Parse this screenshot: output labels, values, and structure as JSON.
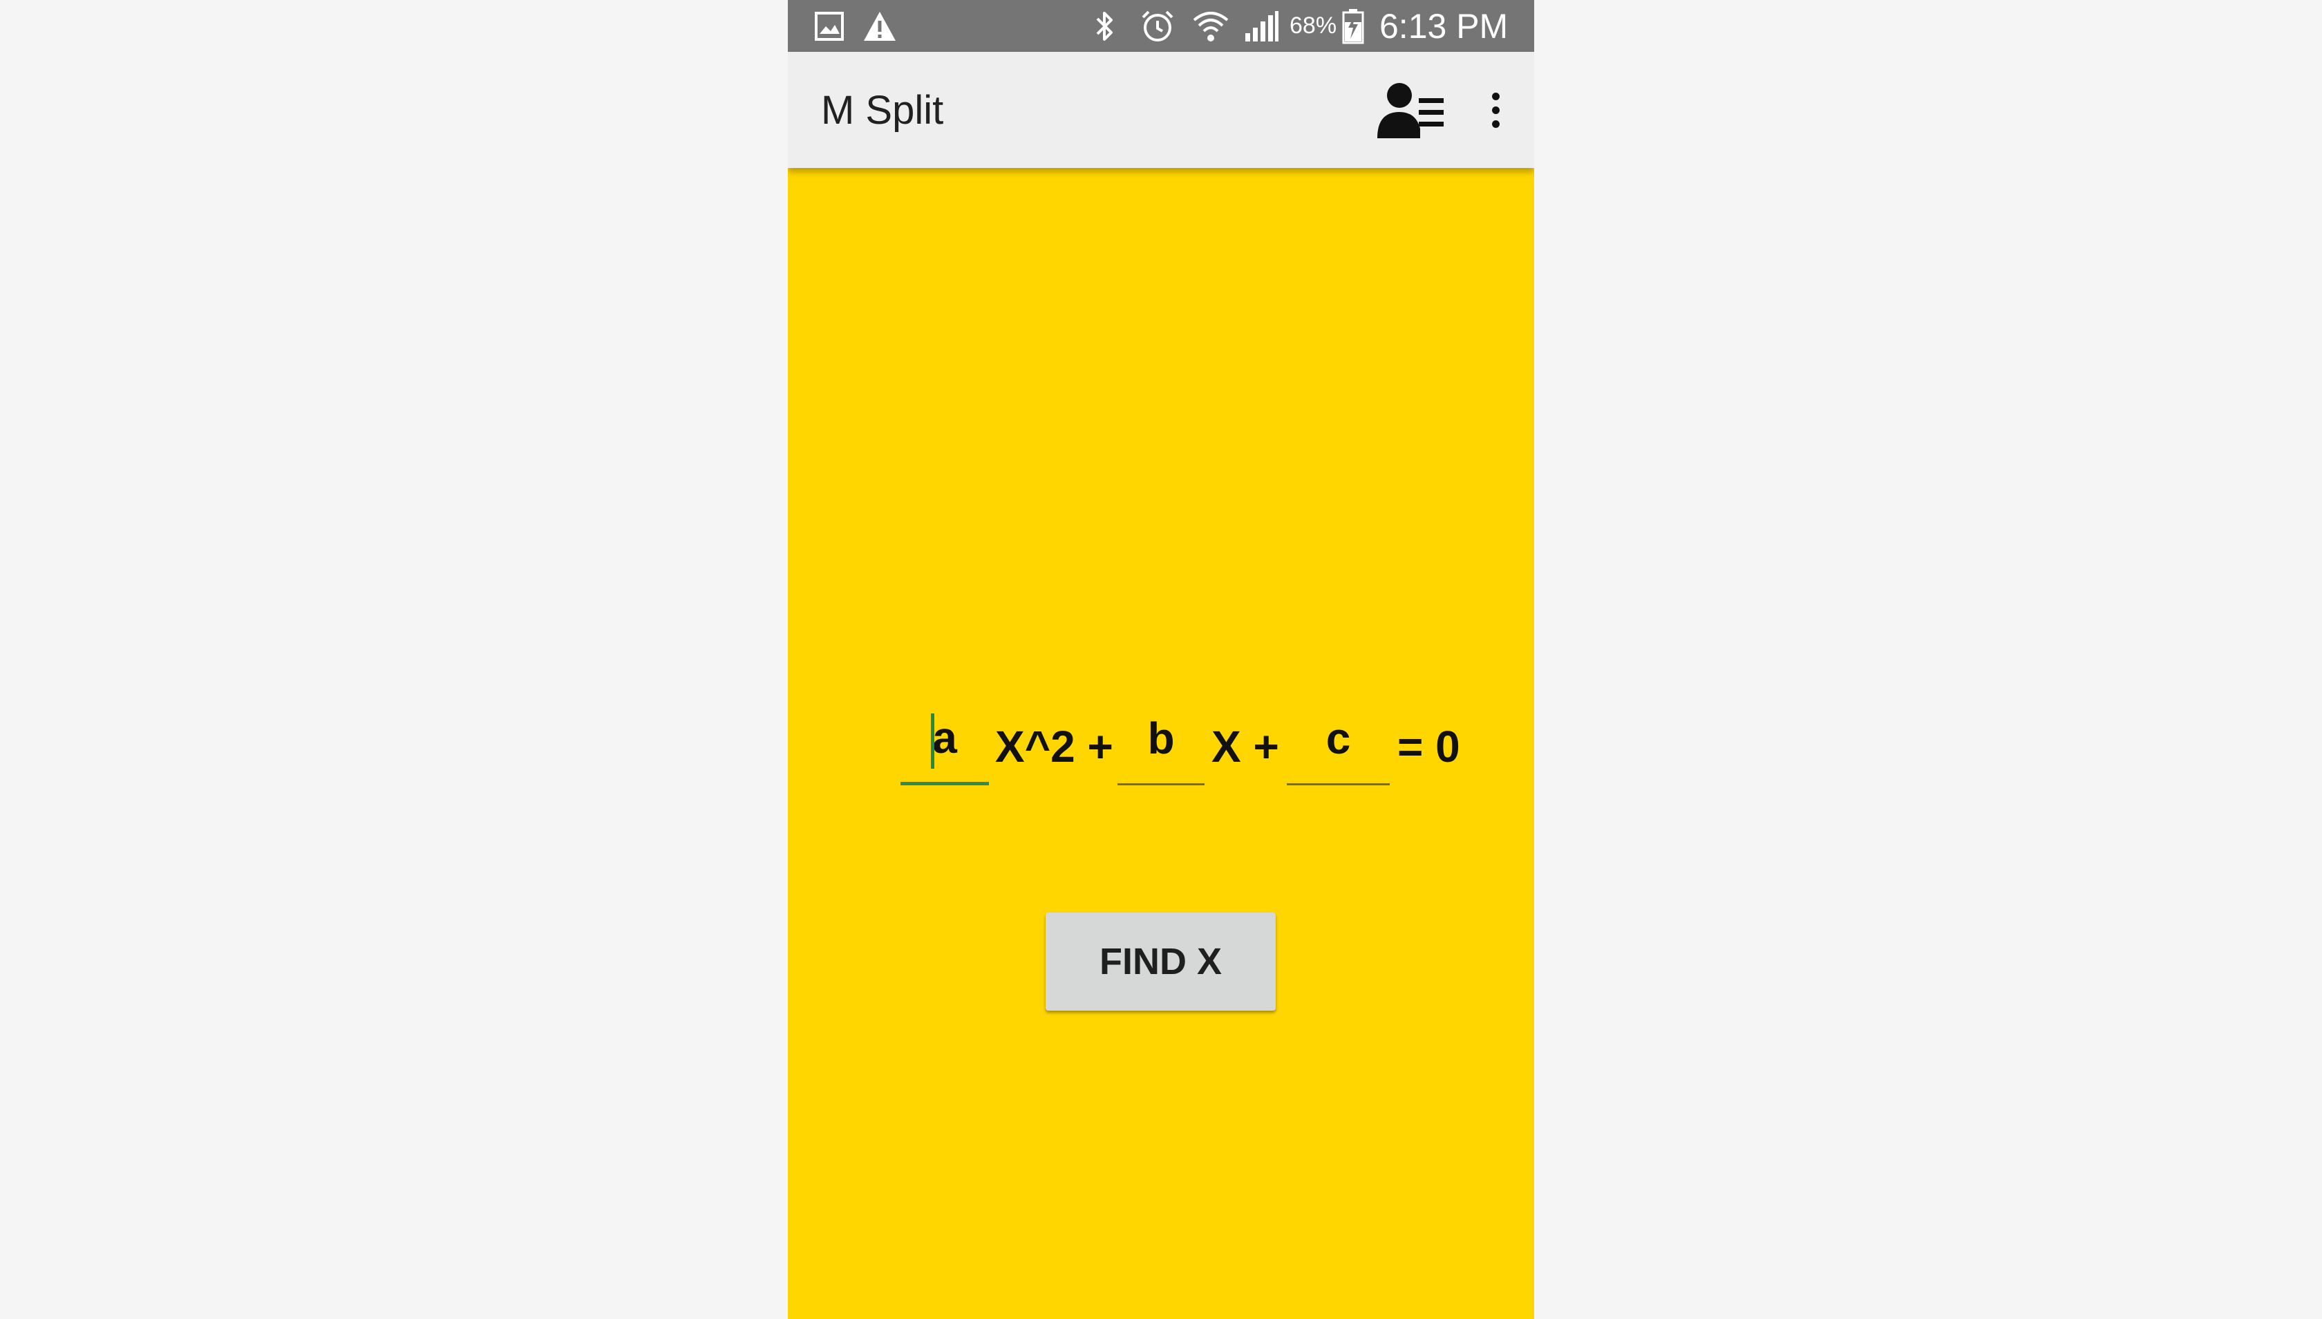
{
  "status_bar": {
    "icons": [
      "gallery-icon",
      "warning-icon",
      "bluetooth-icon",
      "alarm-icon",
      "wifi-icon",
      "signal-icon",
      "battery-charging-icon"
    ],
    "battery": "68%",
    "time": "6:13 PM"
  },
  "app_bar": {
    "title": "M Split",
    "actions": [
      "contacts-list-icon",
      "overflow-menu-icon"
    ]
  },
  "equation": {
    "a_placeholder": "a",
    "term1": "X^2 +",
    "b_placeholder": "b",
    "term2": "X +",
    "c_placeholder": "c",
    "term3": "= 0"
  },
  "button": {
    "find_label": "FIND X"
  },
  "colors": {
    "background": "#ffd600",
    "status_bar": "#757575",
    "app_bar": "#eeeeee",
    "button": "#d6d7d7",
    "focus_accent": "#2e8b57"
  }
}
